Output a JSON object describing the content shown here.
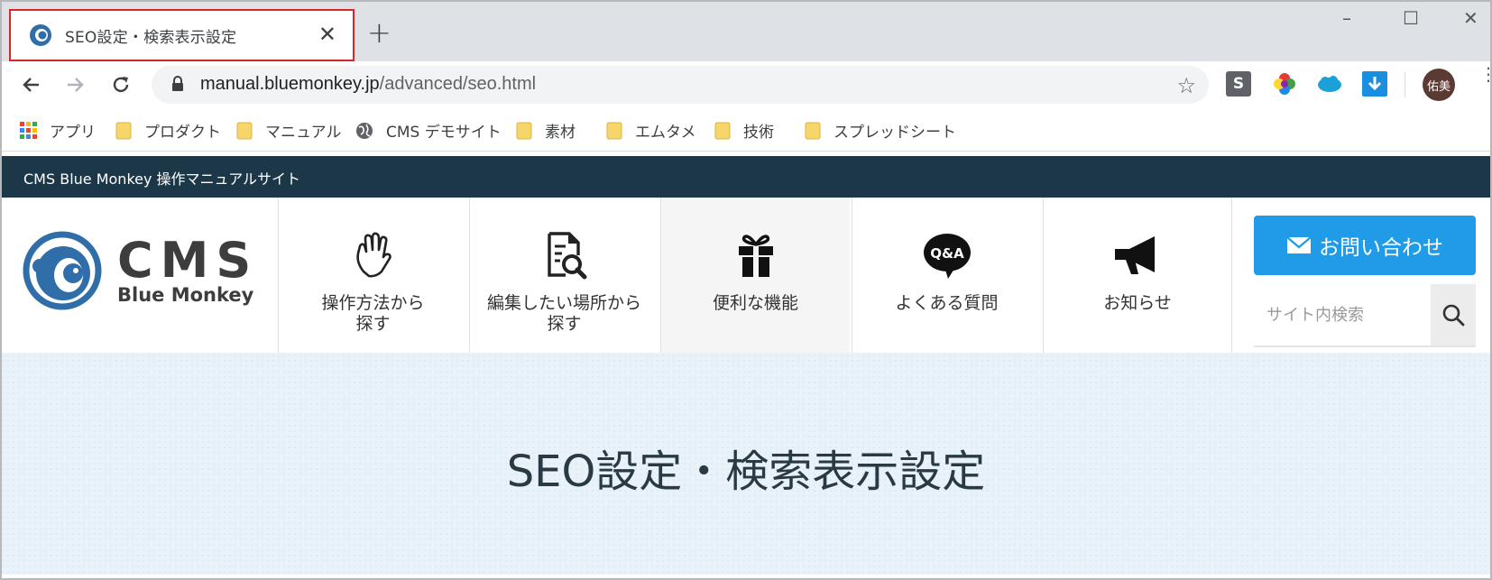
{
  "browser": {
    "tab": {
      "title": "SEO設定・検索表示設定",
      "close_label": "✕"
    },
    "new_tab_label": "+",
    "window_controls": {
      "minimize": "–",
      "maximize": "☐",
      "close": "✕"
    },
    "url_host": "manual.bluemonkey.jp",
    "url_path": "/advanced/seo.html",
    "avatar_text": "佑美",
    "extensions": [
      {
        "name": "s-extension-icon",
        "label": "S"
      },
      {
        "name": "color-picker-icon",
        "label": ""
      },
      {
        "name": "salesforce-icon",
        "label": ""
      },
      {
        "name": "download-icon",
        "label": ""
      }
    ],
    "bookmarks": [
      {
        "label": "アプリ",
        "type": "apps"
      },
      {
        "label": "プロダクト",
        "type": "folder"
      },
      {
        "label": "マニュアル",
        "type": "folder"
      },
      {
        "label": "CMS デモサイト",
        "type": "globe"
      },
      {
        "label": "素材",
        "type": "folder"
      },
      {
        "label": "エムタメ",
        "type": "folder"
      },
      {
        "label": "技術",
        "type": "folder"
      },
      {
        "label": "スプレッドシート",
        "type": "folder"
      }
    ]
  },
  "site": {
    "topbar_title": "CMS Blue Monkey 操作マニュアルサイト",
    "logo": {
      "main": "CMS",
      "sub": "Blue Monkey"
    },
    "nav": [
      {
        "label_line1": "操作方法から",
        "label_line2": "探す",
        "icon": "hand-icon"
      },
      {
        "label_line1": "編集したい場所から",
        "label_line2": "探す",
        "icon": "document-search-icon"
      },
      {
        "label_line1": "便利な機能",
        "label_line2": "",
        "icon": "gift-icon"
      },
      {
        "label_line1": "よくある質問",
        "label_line2": "",
        "icon": "qa-bubble-icon"
      },
      {
        "label_line1": "お知らせ",
        "label_line2": "",
        "icon": "megaphone-icon"
      }
    ],
    "contact_label": "お問い合わせ",
    "search_placeholder": "サイト内検索",
    "qa_icon_text": "Q&A",
    "hero_title": "SEO設定・検索表示設定"
  },
  "colors": {
    "topbar": "#1c3748",
    "contact_button": "#1f9be8",
    "logo_blue": "#2f6ea8",
    "tab_highlight": "#d9262d",
    "hero_bg": "#e9f2f9"
  }
}
